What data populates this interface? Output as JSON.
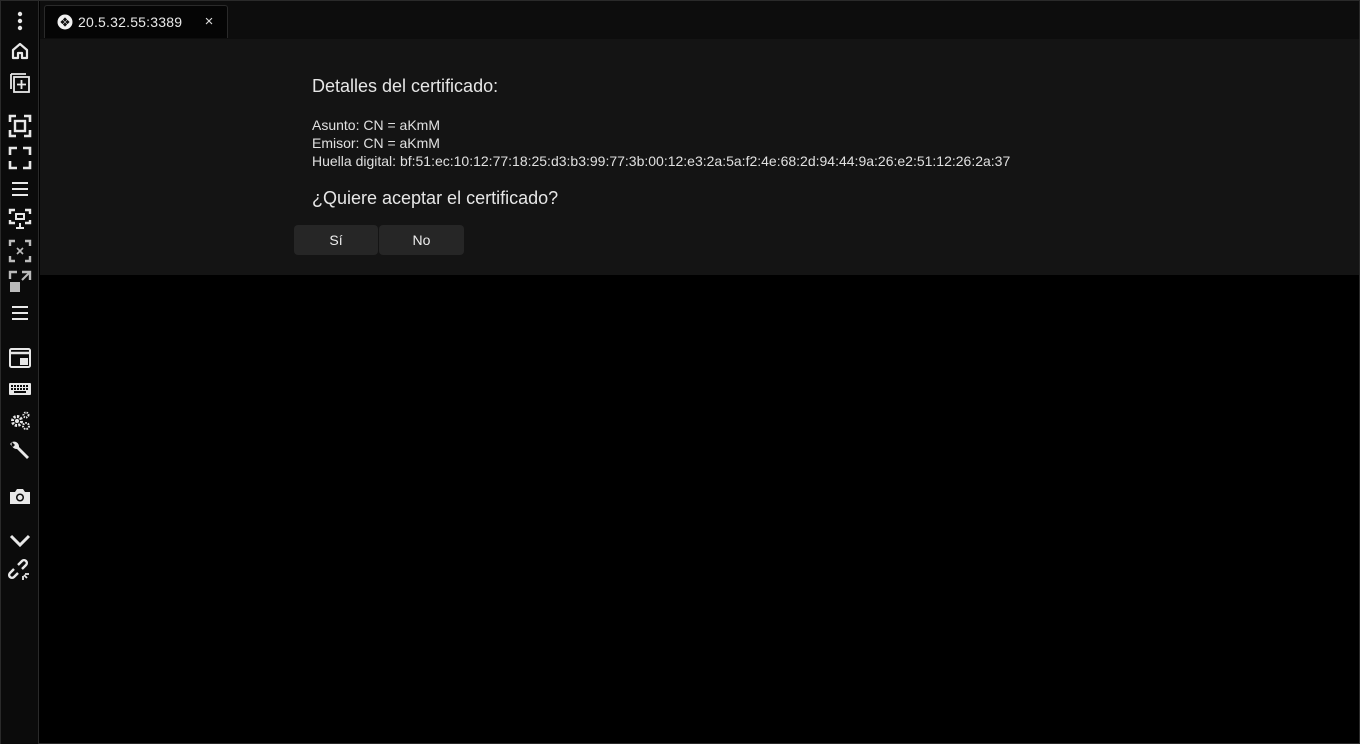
{
  "tab": {
    "title": "20.5.32.55:3389",
    "close_glyph": "×",
    "logo_icon": "remote-desktop-logo-icon"
  },
  "sidebar": {
    "icons": [
      "more-vertical-icon",
      "home-icon",
      "new-tab-icon",
      "focus-icon",
      "fullscreen-icon",
      "menu-icon",
      "display-icon",
      "selection-icon",
      "scale-icon",
      "menu-icon",
      "window-icon",
      "keyboard-icon",
      "settings-icon",
      "wrench-icon",
      "camera-icon",
      "chevron-down-icon",
      "unlink-icon"
    ]
  },
  "dialog": {
    "heading": "Detalles del certificado:",
    "subject": "Asunto: CN = aKmM",
    "issuer": "Emisor: CN = aKmM",
    "fingerprint": "Huella digital: bf:51:ec:10:12:77:18:25:d3:b3:99:77:3b:00:12:e3:2a:5a:f2:4e:68:2d:94:44:9a:26:e2:51:12:26:2a:37",
    "question": "¿Quiere aceptar el certificado?",
    "yes_label": "Sí",
    "no_label": "No"
  },
  "colors": {
    "background": "#000000",
    "panel": "#141414",
    "button": "#262626",
    "text": "#e6e6e6"
  }
}
